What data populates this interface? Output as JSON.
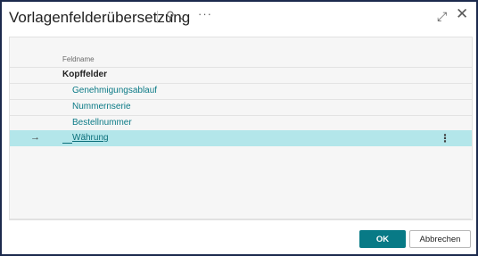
{
  "dialog": {
    "title": "Vorlagenfelderübersetzung",
    "icons": {
      "search": "search-icon",
      "chevron": "chevron-down-icon",
      "more": "more-icon",
      "expand": "expand-icon",
      "close": "close-icon"
    }
  },
  "list": {
    "column_header": "Feldname",
    "rows": [
      {
        "label": "Kopffelder",
        "type": "group"
      },
      {
        "label": "Genehmigungsablauf",
        "type": "child"
      },
      {
        "label": "Nummernserie",
        "type": "child"
      },
      {
        "label": "Bestellnummer",
        "type": "child"
      },
      {
        "label": "Währung",
        "type": "child",
        "selected": true
      }
    ]
  },
  "footer": {
    "ok_label": "OK",
    "cancel_label": "Abbrechen"
  },
  "colors": {
    "accent": "#087a86",
    "selected_row": "#b3e6ea",
    "border": "#1c2a4d"
  }
}
